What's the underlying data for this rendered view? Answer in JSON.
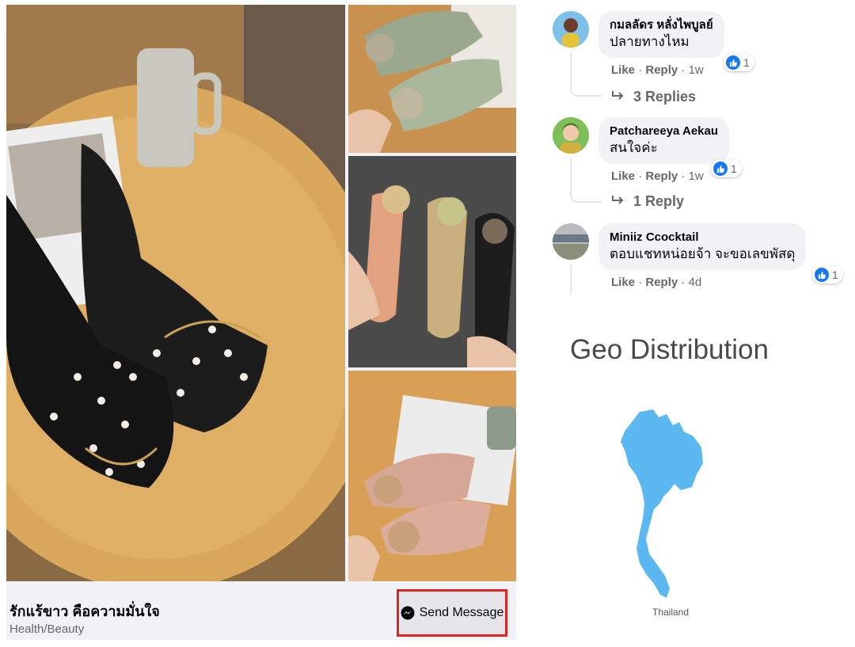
{
  "ad": {
    "title": "รักแร้ขาว คือความมั่นใจ",
    "category": "Health/Beauty",
    "cta_label": "Send Message",
    "highlight_color": "#e02424"
  },
  "comments": [
    {
      "author": "กมลลัดร หลั่งไพบูลย์",
      "text": "ปลายทางไหม",
      "like_label": "Like",
      "reply_label": "Reply",
      "time": "1w",
      "reactions": "1",
      "replies_label": "3 Replies"
    },
    {
      "author": "Patchareeya Aekau",
      "text": "สนใจค่ะ",
      "like_label": "Like",
      "reply_label": "Reply",
      "time": "1w",
      "reactions": "1",
      "replies_label": "1 Reply"
    },
    {
      "author": "Miniiz Ccocktail",
      "text": "ตอบแชทหน่อยจ้า จะขอเลขพัสดุ",
      "like_label": "Like",
      "reply_label": "Reply",
      "time": "4d",
      "reactions": "1"
    }
  ],
  "geo": {
    "title": "Geo Distribution",
    "countries": [
      "Thailand"
    ],
    "map_color": "#5bb8f0"
  },
  "icons": {
    "messenger": "messenger-icon",
    "like": "thumbs-up-icon",
    "reply_arrow": "reply-arrow-icon"
  }
}
